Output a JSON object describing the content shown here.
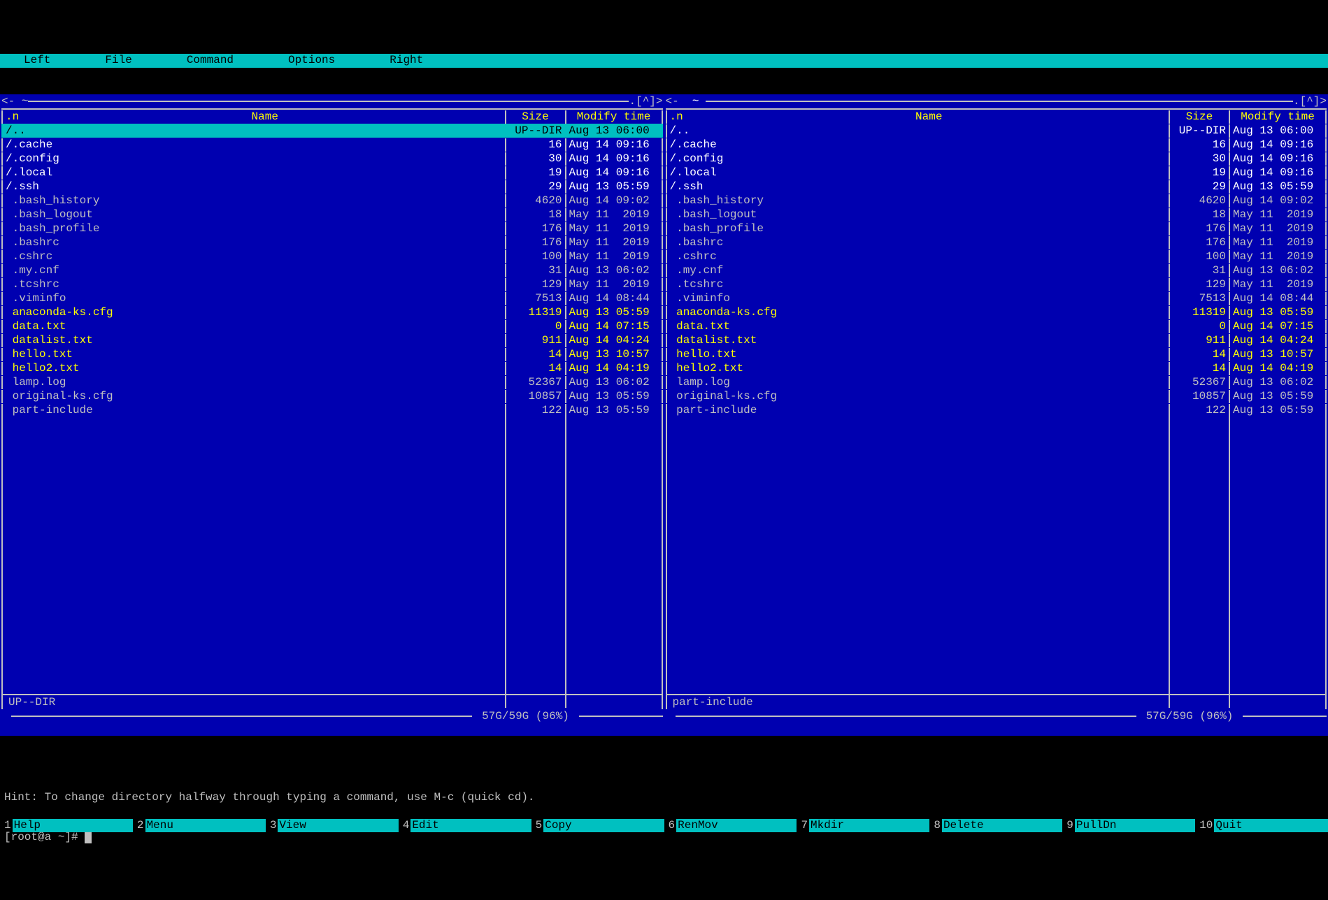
{
  "menubar": {
    "left": "Left",
    "file": "File",
    "command": "Command",
    "options": "Options",
    "right": "Right"
  },
  "left_panel": {
    "path": "~",
    "title_arrow_left": "<-",
    "title_caret": ".[^]>",
    "header_n": ".n",
    "header_name": "Name",
    "header_size": "Size",
    "header_mtime": "Modify time",
    "footer_info": "UP--DIR",
    "disk_stats": "57G/59G (96%)",
    "rows": [
      {
        "name": "/..",
        "size": "UP--DIR",
        "mtime": "Aug 13 06:00",
        "type": "dir",
        "selected": true
      },
      {
        "name": "/.cache",
        "size": "16",
        "mtime": "Aug 14 09:16",
        "type": "dir"
      },
      {
        "name": "/.config",
        "size": "30",
        "mtime": "Aug 14 09:16",
        "type": "dir"
      },
      {
        "name": "/.local",
        "size": "19",
        "mtime": "Aug 14 09:16",
        "type": "dir"
      },
      {
        "name": "/.ssh",
        "size": "29",
        "mtime": "Aug 13 05:59",
        "type": "dir"
      },
      {
        "name": " .bash_history",
        "size": "4620",
        "mtime": "Aug 14 09:02",
        "type": "file"
      },
      {
        "name": " .bash_logout",
        "size": "18",
        "mtime": "May 11  2019",
        "type": "file"
      },
      {
        "name": " .bash_profile",
        "size": "176",
        "mtime": "May 11  2019",
        "type": "file"
      },
      {
        "name": " .bashrc",
        "size": "176",
        "mtime": "May 11  2019",
        "type": "file"
      },
      {
        "name": " .cshrc",
        "size": "100",
        "mtime": "May 11  2019",
        "type": "file"
      },
      {
        "name": " .my.cnf",
        "size": "31",
        "mtime": "Aug 13 06:02",
        "type": "file"
      },
      {
        "name": " .tcshrc",
        "size": "129",
        "mtime": "May 11  2019",
        "type": "file"
      },
      {
        "name": " .viminfo",
        "size": "7513",
        "mtime": "Aug 14 08:44",
        "type": "file"
      },
      {
        "name": " anaconda-ks.cfg",
        "size": "11319",
        "mtime": "Aug 13 05:59",
        "type": "yellow"
      },
      {
        "name": " data.txt",
        "size": "0",
        "mtime": "Aug 14 07:15",
        "type": "yellow"
      },
      {
        "name": " datalist.txt",
        "size": "911",
        "mtime": "Aug 14 04:24",
        "type": "yellow"
      },
      {
        "name": " hello.txt",
        "size": "14",
        "mtime": "Aug 13 10:57",
        "type": "yellow"
      },
      {
        "name": " hello2.txt",
        "size": "14",
        "mtime": "Aug 14 04:19",
        "type": "yellow"
      },
      {
        "name": " lamp.log",
        "size": "52367",
        "mtime": "Aug 13 06:02",
        "type": "file"
      },
      {
        "name": " original-ks.cfg",
        "size": "10857",
        "mtime": "Aug 13 05:59",
        "type": "file"
      },
      {
        "name": " part-include",
        "size": "122",
        "mtime": "Aug 13 05:59",
        "type": "file"
      }
    ]
  },
  "right_panel": {
    "path": "~",
    "title_arrow_left": "<-",
    "title_caret": ".[^]>",
    "header_n": ".n",
    "header_name": "Name",
    "header_size": "Size",
    "header_mtime": "Modify time",
    "footer_info": "part-include",
    "disk_stats": "57G/59G (96%)",
    "rows": [
      {
        "name": "/..",
        "size": "UP--DIR",
        "mtime": "Aug 13 06:00",
        "type": "dir"
      },
      {
        "name": "/.cache",
        "size": "16",
        "mtime": "Aug 14 09:16",
        "type": "dir"
      },
      {
        "name": "/.config",
        "size": "30",
        "mtime": "Aug 14 09:16",
        "type": "dir"
      },
      {
        "name": "/.local",
        "size": "19",
        "mtime": "Aug 14 09:16",
        "type": "dir"
      },
      {
        "name": "/.ssh",
        "size": "29",
        "mtime": "Aug 13 05:59",
        "type": "dir"
      },
      {
        "name": " .bash_history",
        "size": "4620",
        "mtime": "Aug 14 09:02",
        "type": "file"
      },
      {
        "name": " .bash_logout",
        "size": "18",
        "mtime": "May 11  2019",
        "type": "file"
      },
      {
        "name": " .bash_profile",
        "size": "176",
        "mtime": "May 11  2019",
        "type": "file"
      },
      {
        "name": " .bashrc",
        "size": "176",
        "mtime": "May 11  2019",
        "type": "file"
      },
      {
        "name": " .cshrc",
        "size": "100",
        "mtime": "May 11  2019",
        "type": "file"
      },
      {
        "name": " .my.cnf",
        "size": "31",
        "mtime": "Aug 13 06:02",
        "type": "file"
      },
      {
        "name": " .tcshrc",
        "size": "129",
        "mtime": "May 11  2019",
        "type": "file"
      },
      {
        "name": " .viminfo",
        "size": "7513",
        "mtime": "Aug 14 08:44",
        "type": "file"
      },
      {
        "name": " anaconda-ks.cfg",
        "size": "11319",
        "mtime": "Aug 13 05:59",
        "type": "yellow"
      },
      {
        "name": " data.txt",
        "size": "0",
        "mtime": "Aug 14 07:15",
        "type": "yellow"
      },
      {
        "name": " datalist.txt",
        "size": "911",
        "mtime": "Aug 14 04:24",
        "type": "yellow"
      },
      {
        "name": " hello.txt",
        "size": "14",
        "mtime": "Aug 13 10:57",
        "type": "yellow"
      },
      {
        "name": " hello2.txt",
        "size": "14",
        "mtime": "Aug 14 04:19",
        "type": "yellow"
      },
      {
        "name": " lamp.log",
        "size": "52367",
        "mtime": "Aug 13 06:02",
        "type": "file"
      },
      {
        "name": " original-ks.cfg",
        "size": "10857",
        "mtime": "Aug 13 05:59",
        "type": "file"
      },
      {
        "name": " part-include",
        "size": "122",
        "mtime": "Aug 13 05:59",
        "type": "file"
      }
    ]
  },
  "hint": "Hint: To change directory halfway through typing a command, use M-c (quick cd).",
  "prompt": "[root@a ~]# ",
  "fkeys": [
    {
      "n": "1",
      "label": "Help"
    },
    {
      "n": "2",
      "label": "Menu"
    },
    {
      "n": "3",
      "label": "View"
    },
    {
      "n": "4",
      "label": "Edit"
    },
    {
      "n": "5",
      "label": "Copy"
    },
    {
      "n": "6",
      "label": "RenMov"
    },
    {
      "n": "7",
      "label": "Mkdir"
    },
    {
      "n": "8",
      "label": "Delete"
    },
    {
      "n": "9",
      "label": "PullDn"
    },
    {
      "n": "10",
      "label": "Quit"
    }
  ]
}
